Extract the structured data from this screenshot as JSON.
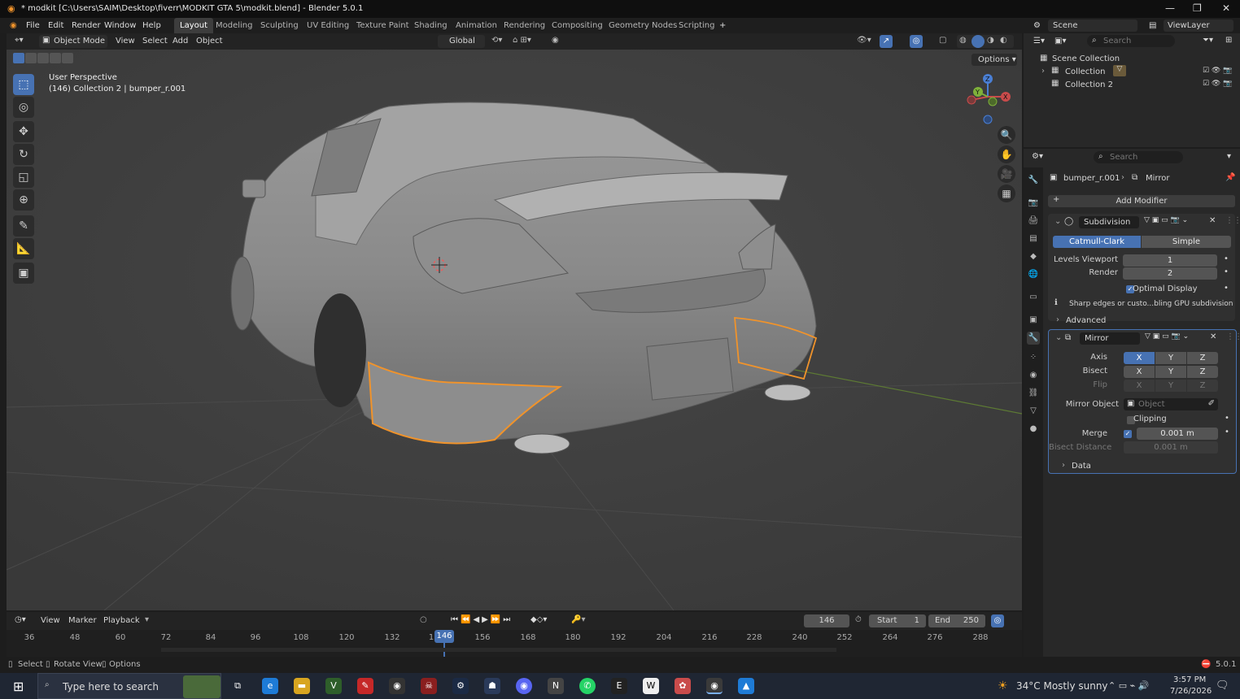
{
  "window": {
    "title": "* modkit [C:\\Users\\SAIM\\Desktop\\fiverr\\MODKIT GTA 5\\modkit.blend] - Blender 5.0.1",
    "minimize": "—",
    "maximize": "❐",
    "close": "✕"
  },
  "menu": {
    "items": [
      "File",
      "Edit",
      "Render",
      "Window",
      "Help"
    ]
  },
  "workspaces": [
    "Layout",
    "Modeling",
    "Sculpting",
    "UV Editing",
    "Texture Paint",
    "Shading",
    "Animation",
    "Rendering",
    "Compositing",
    "Geometry Nodes",
    "Scripting"
  ],
  "add_workspace": "+",
  "scene": {
    "name": "Scene",
    "viewlayer": "ViewLayer"
  },
  "viewport_header": {
    "mode": "Object Mode",
    "menus": [
      "View",
      "Select",
      "Add",
      "Object"
    ],
    "orientation": "Global",
    "options": "Options"
  },
  "viewport": {
    "perspective": "User Perspective",
    "object_info": "(146) Collection 2 | bumper_r.001",
    "gizmo_axes": {
      "x": "X",
      "y": "Y",
      "z": "Z"
    }
  },
  "outliner": {
    "search_placeholder": "Search",
    "root": "Scene Collection",
    "collections": [
      "Collection",
      "Collection 2"
    ]
  },
  "properties": {
    "search_placeholder": "Search",
    "breadcrumb_object": "bumper_r.001",
    "breadcrumb_modifier": "Mirror",
    "add_modifier": "Add Modifier",
    "subdivision": {
      "name": "Subdivision",
      "type_a": "Catmull-Clark",
      "type_b": "Simple",
      "levels_label": "Levels Viewport",
      "levels_value": "1",
      "render_label": "Render",
      "render_value": "2",
      "optimal_label": "Optimal Display",
      "info": "Sharp edges or custo...bling GPU subdivision",
      "advanced": "Advanced"
    },
    "mirror": {
      "name": "Mirror",
      "axis_label": "Axis",
      "bisect_label": "Bisect",
      "flip_label": "Flip",
      "x": "X",
      "y": "Y",
      "z": "Z",
      "object_label": "Mirror Object",
      "object_placeholder": "Object",
      "clipping_label": "Clipping",
      "merge_label": "Merge",
      "merge_value": "0.001 m",
      "bisect_distance_label": "Bisect Distance",
      "bisect_distance_value": "0.001 m",
      "data": "Data"
    }
  },
  "timeline": {
    "menus": [
      "View",
      "Marker",
      "Playback"
    ],
    "current_frame": "146",
    "start_label": "Start",
    "start": "1",
    "end_label": "End",
    "end": "250",
    "ticks": [
      "36",
      "48",
      "60",
      "72",
      "84",
      "96",
      "108",
      "120",
      "132",
      "1",
      "156",
      "168",
      "180",
      "192",
      "204",
      "216",
      "228",
      "240",
      "252",
      "264",
      "276",
      "288"
    ],
    "current_tick": "146"
  },
  "statusbar": {
    "select": "Select",
    "rotate": "Rotate View",
    "options": "Options",
    "version": "5.0.1"
  },
  "taskbar": {
    "search": "Type here to search",
    "weather": "34°C  Mostly sunny",
    "time": "3:57 PM",
    "date": "7/26/2026"
  },
  "colors": {
    "accent": "#4772b3",
    "selection": "#f0932b",
    "viewport_bg": "#3d3d3d"
  }
}
